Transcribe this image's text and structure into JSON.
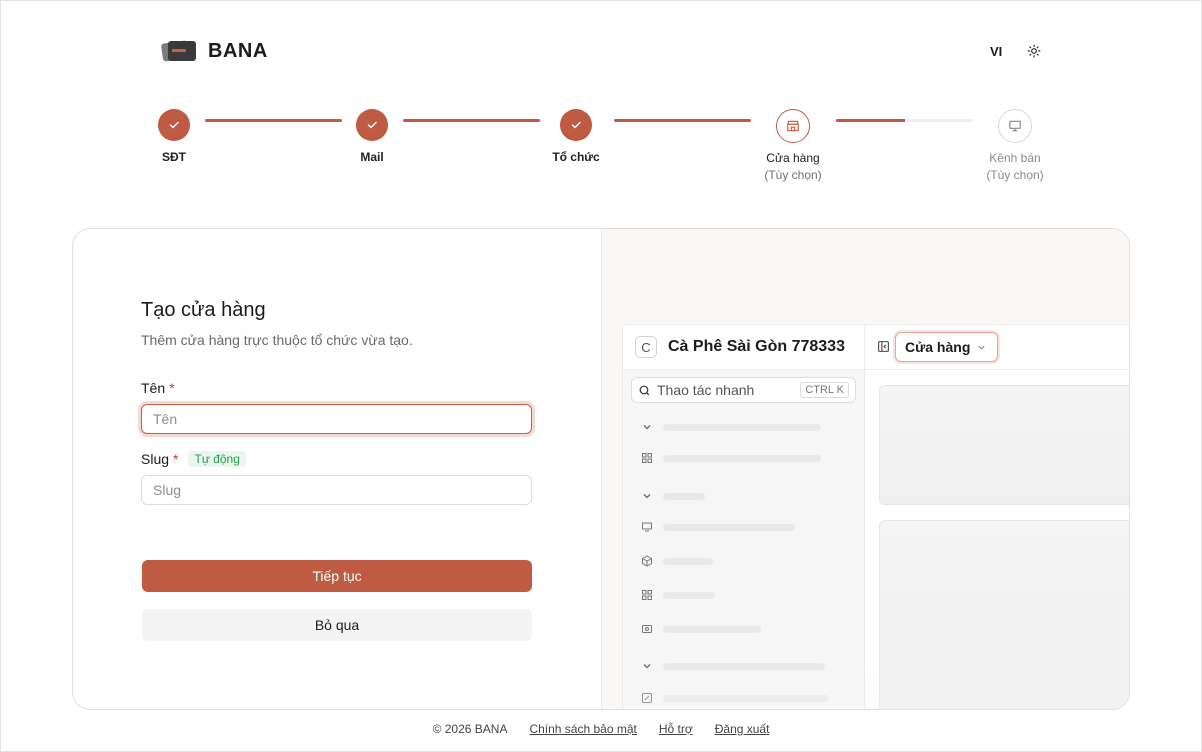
{
  "header": {
    "brand": "BANA",
    "lang": "VI",
    "icons": {
      "logo": "card-stack-icon",
      "theme": "sun-icon"
    }
  },
  "stepper": {
    "steps": [
      {
        "label": "SĐT",
        "state": "done"
      },
      {
        "label": "Mail",
        "state": "done"
      },
      {
        "label": "Tổ chức",
        "state": "done"
      },
      {
        "label": "Cửa hàng",
        "sub": "(Tùy chọn)",
        "state": "active",
        "icon": "store-icon"
      },
      {
        "label": "Kênh bán",
        "sub": "(Tùy chọn)",
        "state": "todo",
        "icon": "monitor-icon"
      }
    ],
    "connector_progress": [
      1,
      1,
      1,
      0.5
    ],
    "accent": "#bf5b42"
  },
  "form": {
    "title": "Tạo cửa hàng",
    "subtitle": "Thêm cửa hàng trực thuộc tổ chức vừa tạo.",
    "name_label": "Tên",
    "name_required": "*",
    "name_value": "",
    "name_placeholder": "Tên",
    "slug_label": "Slug",
    "slug_required": "*",
    "slug_badge": "Tự động",
    "slug_value": "",
    "slug_placeholder": "Slug",
    "continue_label": "Tiếp tục",
    "skip_label": "Bỏ qua"
  },
  "preview": {
    "org_initial": "C",
    "org_name": "Cà Phê Sài Gòn 778333",
    "store_chip": "Cửa hàng",
    "search_placeholder": "Thao tác nhanh",
    "search_shortcut": "CTRL K"
  },
  "footer": {
    "copyright": "© 2026 BANA",
    "privacy": "Chính sách bảo mật",
    "support": "Hỗ trợ",
    "logout": "Đăng xuất"
  }
}
